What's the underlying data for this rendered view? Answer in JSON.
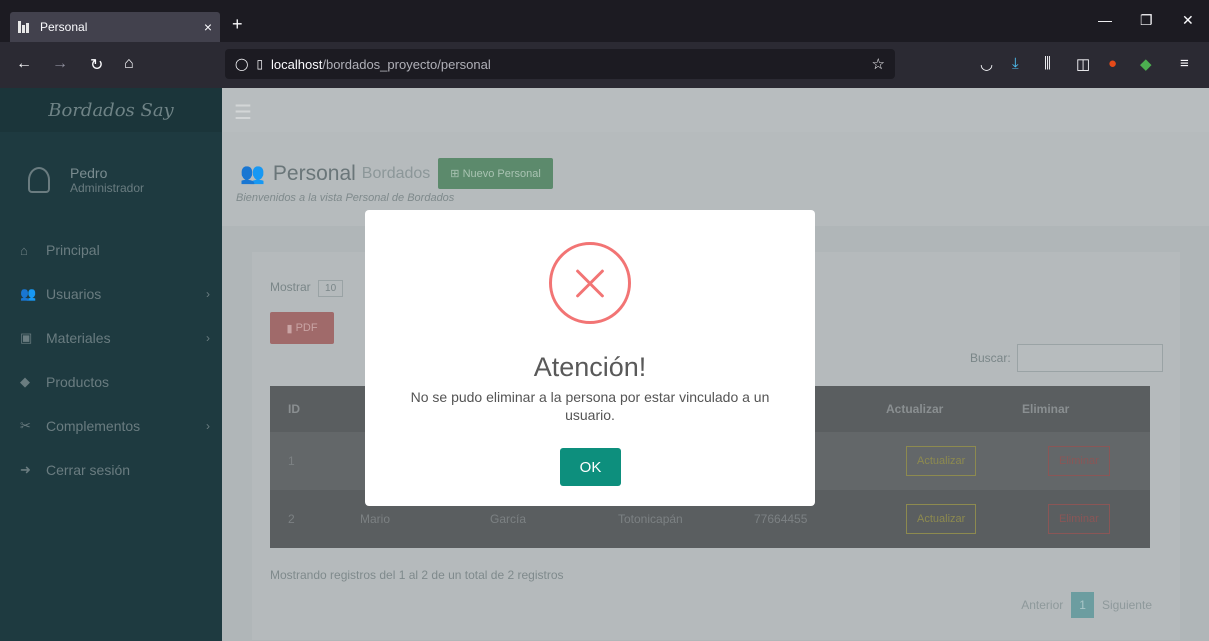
{
  "browser": {
    "tab_title": "Personal",
    "tab_close": "×",
    "new_tab": "+",
    "url_host": "localhost",
    "url_path": "/bordados_proyecto/personal",
    "window_controls": [
      "—",
      "❐",
      "✕"
    ]
  },
  "sidebar": {
    "brand": "Bordados Say",
    "user_name": "Pedro",
    "user_role": "Administrador",
    "items": [
      {
        "label": "Principal",
        "icon": "home-icon",
        "glyph": "⌂"
      },
      {
        "label": "Usuarios",
        "icon": "users-icon",
        "glyph": "👥",
        "chevron": "›"
      },
      {
        "label": "Materiales",
        "icon": "box-icon",
        "glyph": "▣",
        "chevron": "›"
      },
      {
        "label": "Productos",
        "icon": "bag-icon",
        "glyph": "◆"
      },
      {
        "label": "Complementos",
        "icon": "tools-icon",
        "glyph": "✂",
        "chevron": "›"
      },
      {
        "label": "Cerrar sesión",
        "icon": "logout-icon",
        "glyph": "➜"
      }
    ]
  },
  "header": {
    "title": "Personal",
    "subtitle": "Bordados",
    "new_button": "Nuevo Personal",
    "description": "Bienvenidos a la vista Personal de Bordados"
  },
  "table_controls": {
    "show_label": "Mostrar",
    "show_value": "10",
    "pdf_button": "PDF",
    "search_label": "Buscar:"
  },
  "table": {
    "columns": [
      "ID",
      "Actualizar",
      "Eliminar"
    ],
    "rows": [
      {
        "id": "1",
        "name": "",
        "lastname": "",
        "place": "",
        "phone": "",
        "update": "Actualizar",
        "delete": "Eliminar"
      },
      {
        "id": "2",
        "name": "Mario",
        "lastname": "García",
        "place": "Totonicapán",
        "phone": "77664455",
        "update": "Actualizar",
        "delete": "Eliminar"
      }
    ]
  },
  "footer": {
    "info": "Mostrando registros del 1 al 2 de un total de 2 registros",
    "prev": "Anterior",
    "page": "1",
    "next": "Siguiente"
  },
  "modal": {
    "title": "Atención!",
    "message": "No se pudo eliminar a la persona por estar vinculado a un usuario.",
    "ok_label": "OK",
    "icon": "error-icon",
    "accent": "#f27474",
    "button_color": "#0d8f7d"
  }
}
